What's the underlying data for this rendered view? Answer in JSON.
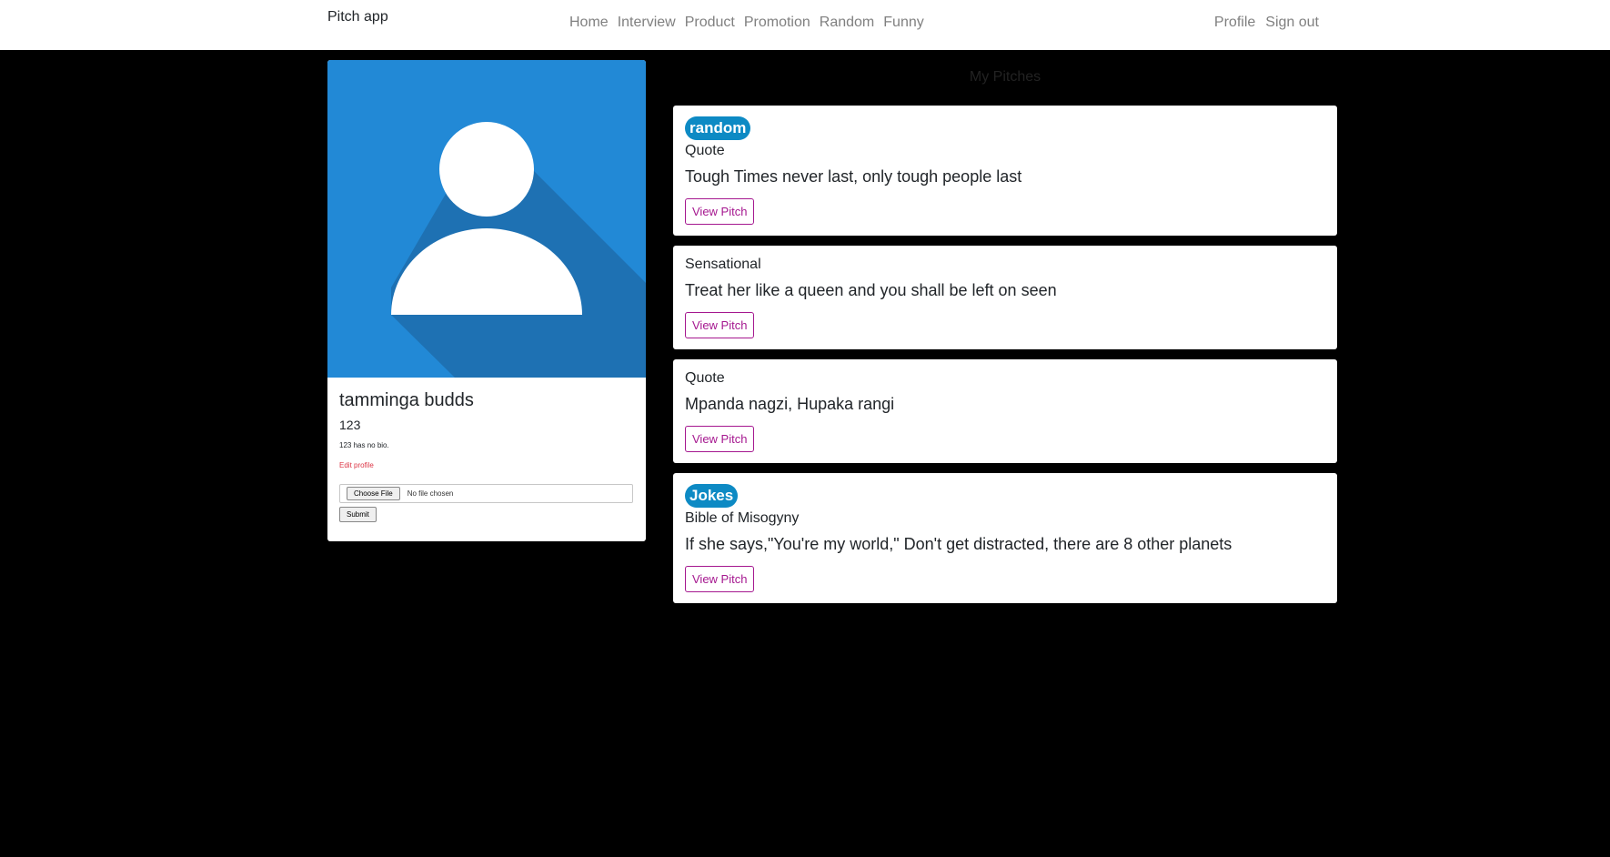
{
  "navbar": {
    "brand": "Pitch app",
    "center_links": [
      "Home",
      "Interview",
      "Product",
      "Promotion",
      "Random",
      "Funny"
    ],
    "right_links": [
      "Profile",
      "Sign out"
    ]
  },
  "profile": {
    "name": "tamminga budds",
    "username": "123",
    "bio": "123 has no bio.",
    "edit_label": "Edit profile",
    "file_button": "Choose File",
    "file_status": "No file chosen",
    "submit_label": "Submit",
    "avatar_icon": "user-avatar-icon",
    "avatar_bg": "#2289d6"
  },
  "pitches": {
    "heading": "My Pitches",
    "items": [
      {
        "badge": "random",
        "title": "Quote",
        "text": "Tough Times never last, only tough people last",
        "button": "View Pitch"
      },
      {
        "badge": "",
        "title": "Sensational",
        "text": "Treat her like a queen and you shall be left on seen",
        "button": "View Pitch"
      },
      {
        "badge": "",
        "title": "Quote",
        "text": "Mpanda nagzi, Hupaka rangi",
        "button": "View Pitch"
      },
      {
        "badge": "Jokes",
        "title": "Bible of Misogyny",
        "text": "If she says,\"You're my world,\" Don't get distracted, there are 8 other planets",
        "button": "View Pitch"
      }
    ]
  },
  "colors": {
    "badge": "#0d8ac4",
    "view_button": "#a5178f",
    "edit_link": "#dc3545"
  }
}
